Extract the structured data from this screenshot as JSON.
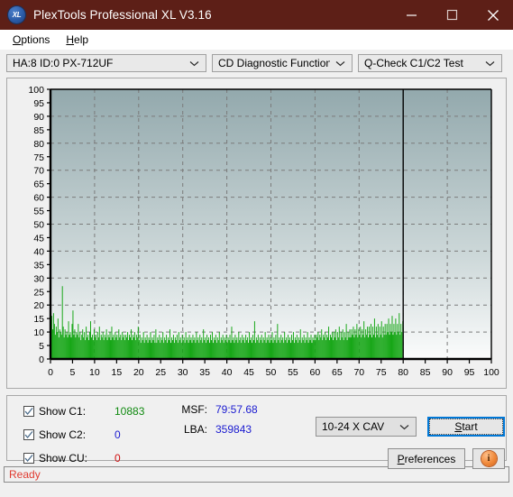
{
  "titlebar": {
    "title": "PlexTools Professional XL V3.16",
    "logo_text": "XL",
    "minimize_icon": "minimize-icon",
    "maximize_icon": "maximize-icon",
    "close_icon": "close-icon",
    "color": "#5d1f17"
  },
  "menubar": {
    "items": [
      {
        "label": "Options",
        "accel": "O"
      },
      {
        "label": "Help",
        "accel": "H"
      }
    ]
  },
  "toolbar": {
    "drive_select": {
      "value": "HA:8 ID:0  PX-712UF",
      "icon": "chevron-down-icon"
    },
    "function_select": {
      "value": "CD Diagnostic Functions",
      "icon": "chevron-down-icon"
    },
    "test_select": {
      "value": "Q-Check C1/C2 Test",
      "icon": "chevron-down-icon"
    }
  },
  "controls": {
    "checkboxes": [
      {
        "label": "Show C1:",
        "checked": true,
        "value": "10883",
        "color": "#108a10",
        "name": "show-c1"
      },
      {
        "label": "Show C2:",
        "checked": true,
        "value": "0",
        "color": "#1a1ad0",
        "name": "show-c2"
      },
      {
        "label": "Show CU:",
        "checked": true,
        "value": "0",
        "color": "#d01010",
        "name": "show-cu"
      }
    ],
    "readouts": [
      {
        "key": "MSF:",
        "value": "79:57.68"
      },
      {
        "key": "LBA:",
        "value": "359843"
      }
    ],
    "speed_select": {
      "value": "10-24 X CAV",
      "icon": "chevron-down-icon"
    },
    "start_button": {
      "label": "Start",
      "accel": "S"
    },
    "preferences_button": {
      "label": "Preferences",
      "accel": "P"
    },
    "info_button": {
      "icon": "info-icon",
      "glyph": "i"
    }
  },
  "statusbar": {
    "text": "Ready",
    "color": "#e03a2f"
  },
  "chart_data": {
    "type": "line",
    "title": "",
    "xlabel": "",
    "ylabel": "",
    "xlim": [
      0,
      100
    ],
    "ylim": [
      0,
      100
    ],
    "xticks": [
      0,
      5,
      10,
      15,
      20,
      25,
      30,
      35,
      40,
      45,
      50,
      55,
      60,
      65,
      70,
      75,
      80,
      85,
      90,
      95,
      100
    ],
    "yticks": [
      0,
      5,
      10,
      15,
      20,
      25,
      30,
      35,
      40,
      45,
      50,
      55,
      60,
      65,
      70,
      75,
      80,
      85,
      90,
      95,
      100
    ],
    "grid": true,
    "legend": "none",
    "data_end_x": 80,
    "plot_bg_top": "#93a9ad",
    "plot_bg_bottom": "#fbfcfc",
    "series": [
      {
        "name": "C1",
        "color": "#16a616",
        "type": "impulse",
        "description": "C1 error rate per second, dense vertical spikes from disc start to 80 minutes",
        "values": [
          14,
          16,
          11,
          17,
          13,
          9,
          12,
          10,
          15,
          8,
          11,
          10,
          9,
          27,
          12,
          8,
          11,
          9,
          10,
          8,
          14,
          9,
          10,
          8,
          13,
          18,
          9,
          11,
          8,
          10,
          9,
          13,
          8,
          10,
          7,
          9,
          11,
          8,
          10,
          7,
          12,
          8,
          9,
          7,
          10,
          14,
          8,
          9,
          7,
          11,
          8,
          9,
          7,
          10,
          8,
          12,
          7,
          9,
          8,
          10,
          7,
          9,
          8,
          11,
          7,
          9,
          8,
          10,
          7,
          12,
          8,
          9,
          7,
          10,
          8,
          9,
          7,
          11,
          8,
          9,
          7,
          10,
          8,
          9,
          7,
          9,
          8,
          10,
          7,
          9,
          8,
          11,
          7,
          9,
          8,
          10,
          7,
          9,
          8,
          12,
          7,
          9,
          6,
          8,
          7,
          10,
          6,
          8,
          7,
          9,
          6,
          8,
          7,
          10,
          6,
          8,
          7,
          9,
          6,
          11,
          6,
          8,
          7,
          9,
          6,
          8,
          7,
          10,
          6,
          8,
          7,
          9,
          6,
          8,
          7,
          11,
          6,
          8,
          7,
          9,
          6,
          8,
          7,
          9,
          6,
          10,
          7,
          8,
          6,
          9,
          7,
          8,
          6,
          10,
          7,
          8,
          6,
          9,
          7,
          8,
          6,
          9,
          7,
          8,
          6,
          10,
          7,
          8,
          6,
          9,
          7,
          8,
          6,
          11,
          7,
          8,
          6,
          9,
          7,
          8,
          6,
          9,
          7,
          10,
          6,
          8,
          7,
          9,
          6,
          8,
          7,
          10,
          6,
          8,
          7,
          9,
          6,
          8,
          7,
          9,
          6,
          8,
          7,
          9,
          6,
          12,
          7,
          8,
          6,
          9,
          7,
          8,
          6,
          10,
          7,
          8,
          6,
          9,
          7,
          8,
          6,
          9,
          7,
          8,
          6,
          10,
          7,
          8,
          6,
          9,
          7,
          14,
          6,
          8,
          7,
          9,
          6,
          8,
          7,
          9,
          6,
          8,
          7,
          10,
          6,
          8,
          7,
          9,
          6,
          8,
          7,
          10,
          6,
          8,
          7,
          9,
          6,
          13,
          7,
          8,
          6,
          9,
          7,
          8,
          6,
          10,
          7,
          8,
          6,
          9,
          7,
          8,
          6,
          9,
          7,
          10,
          6,
          8,
          7,
          9,
          6,
          8,
          7,
          11,
          6,
          8,
          7,
          9,
          6,
          8,
          7,
          10,
          6,
          8,
          7,
          9,
          6,
          8,
          7,
          9,
          7,
          9,
          8,
          10,
          7,
          9,
          8,
          11,
          7,
          9,
          8,
          10,
          7,
          9,
          8,
          12,
          7,
          9,
          8,
          10,
          7,
          10,
          8,
          11,
          7,
          10,
          8,
          12,
          7,
          10,
          8,
          11,
          7,
          10,
          8,
          13,
          7,
          10,
          8,
          11,
          8,
          11,
          9,
          12,
          8,
          11,
          9,
          13,
          8,
          11,
          9,
          12,
          8,
          11,
          9,
          14,
          8,
          11,
          9,
          12,
          8,
          12,
          9,
          13,
          8,
          12,
          9,
          15,
          8,
          12,
          9,
          13,
          8,
          12,
          9,
          14,
          8,
          12,
          9,
          13,
          9,
          13,
          10,
          15,
          9,
          13,
          10,
          16,
          9,
          13,
          10,
          15,
          9,
          13,
          10,
          17,
          9,
          13,
          10,
          14
        ]
      }
    ]
  }
}
